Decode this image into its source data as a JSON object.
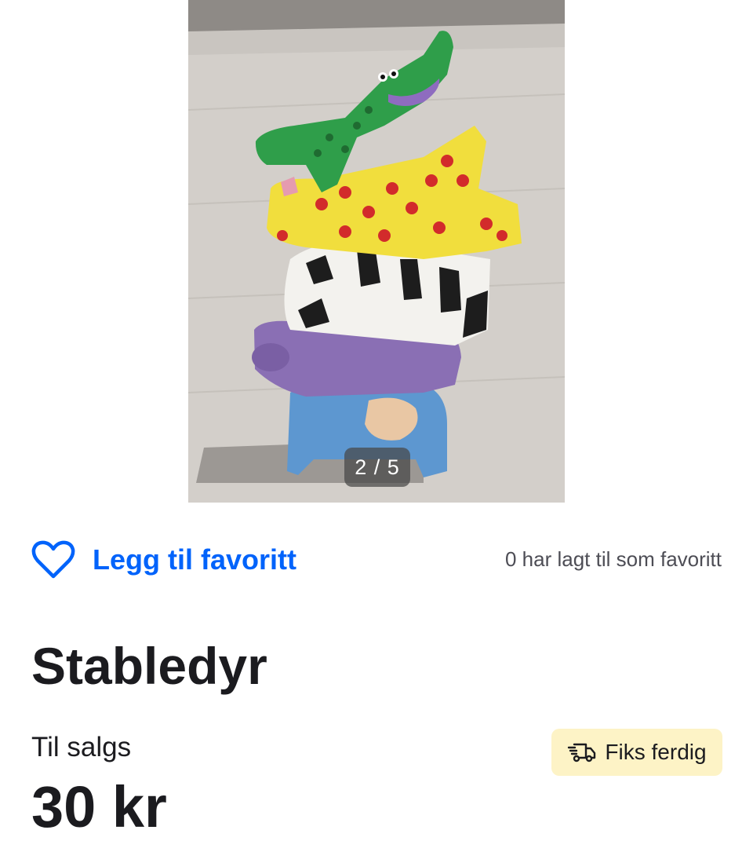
{
  "gallery": {
    "counter": "2 / 5",
    "image_alt": "Stabledyr"
  },
  "favorite": {
    "button_label": "Legg til favoritt",
    "count_text": "0 har lagt til som favoritt"
  },
  "listing": {
    "title": "Stabledyr",
    "status": "Til salgs",
    "price": "30 kr",
    "shipping_badge": "Fiks ferdig"
  },
  "icons": {
    "favorite": "heart-outline-icon",
    "shipping": "delivery-truck-icon"
  },
  "colors": {
    "accent": "#0063fb",
    "badge_bg": "#fdf3c6",
    "text": "#1b1b1f"
  }
}
